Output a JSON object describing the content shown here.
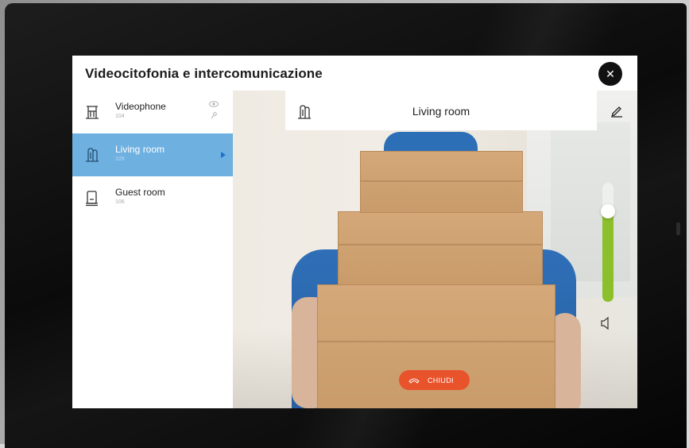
{
  "app": {
    "title": "Videocitofonia e intercomunicazione"
  },
  "header": {
    "close_icon": "close-icon"
  },
  "sidebar": {
    "items": [
      {
        "label": "Videophone",
        "number": "104",
        "icon": "videophone-icon",
        "active": false,
        "extra_icons": [
          "eye-icon",
          "key-icon"
        ]
      },
      {
        "label": "Living room",
        "number": "105",
        "icon": "intercom-icon",
        "active": true,
        "extra_icons": [
          "play-icon"
        ]
      },
      {
        "label": "Guest room",
        "number": "106",
        "icon": "intercom-handset-icon",
        "active": false,
        "extra_icons": []
      }
    ]
  },
  "call": {
    "room_title": "Living room",
    "room_icon": "intercom-icon",
    "edit_icon": "pencil-icon",
    "volume_level": 0.76,
    "volume_icon": "speaker-icon",
    "hangup_label": "CHIUDI",
    "hangup_icon": "hangup-icon"
  },
  "colors": {
    "accent": "#6eb0e0",
    "hangup": "#e8532b",
    "volume": "#8cbf2c",
    "close_button": "#111111"
  }
}
